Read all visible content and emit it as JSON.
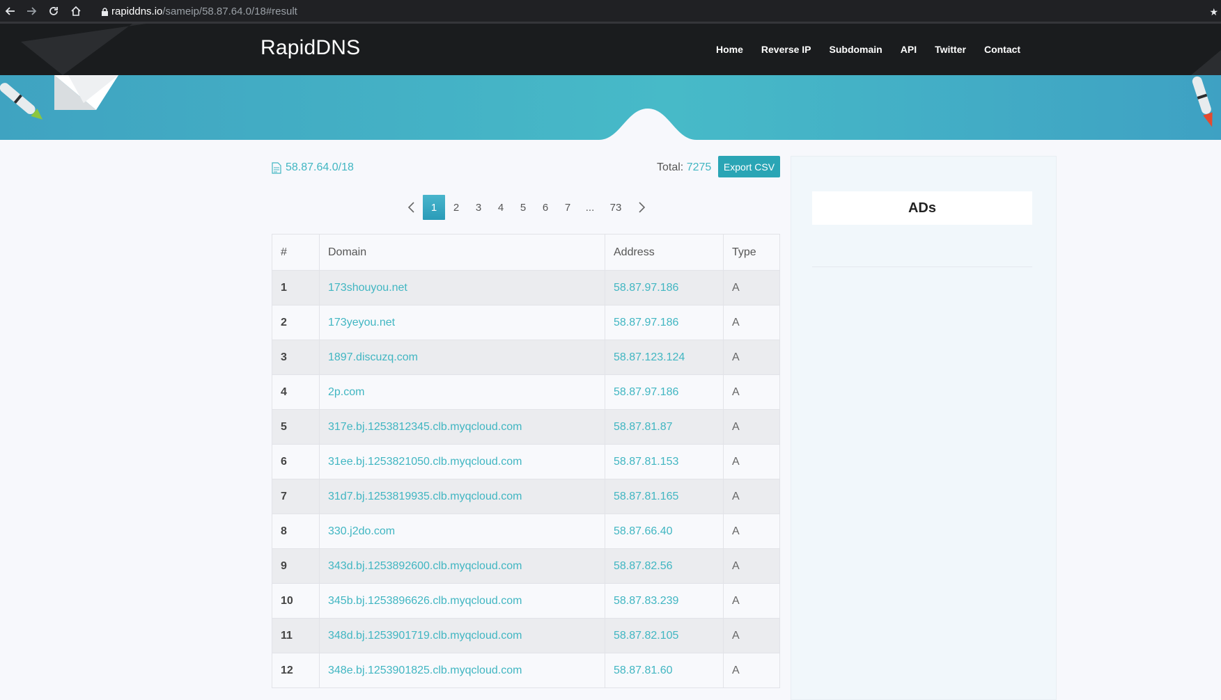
{
  "browser": {
    "url_host": "rapiddns.io",
    "url_path": "/sameip/58.87.64.0/18#result"
  },
  "header": {
    "brand": "RapidDNS",
    "menu": [
      "Home",
      "Reverse IP",
      "Subdomain",
      "API",
      "Twitter",
      "Contact"
    ]
  },
  "result": {
    "query": "58.87.64.0/18",
    "total_label": "Total:",
    "total_value": "7275",
    "export_label": "Export CSV"
  },
  "pagination": {
    "pages": [
      "1",
      "2",
      "3",
      "4",
      "5",
      "6",
      "7",
      "...",
      "73"
    ],
    "active": "1"
  },
  "table": {
    "headers": [
      "#",
      "Domain",
      "Address",
      "Type"
    ],
    "rows": [
      [
        "1",
        "173shouyou.net",
        "58.87.97.186",
        "A"
      ],
      [
        "2",
        "173yeyou.net",
        "58.87.97.186",
        "A"
      ],
      [
        "3",
        "1897.discuzq.com",
        "58.87.123.124",
        "A"
      ],
      [
        "4",
        "2p.com",
        "58.87.97.186",
        "A"
      ],
      [
        "5",
        "317e.bj.1253812345.clb.myqcloud.com",
        "58.87.81.87",
        "A"
      ],
      [
        "6",
        "31ee.bj.1253821050.clb.myqcloud.com",
        "58.87.81.153",
        "A"
      ],
      [
        "7",
        "31d7.bj.1253819935.clb.myqcloud.com",
        "58.87.81.165",
        "A"
      ],
      [
        "8",
        "330.j2do.com",
        "58.87.66.40",
        "A"
      ],
      [
        "9",
        "343d.bj.1253892600.clb.myqcloud.com",
        "58.87.82.56",
        "A"
      ],
      [
        "10",
        "345b.bj.1253896626.clb.myqcloud.com",
        "58.87.83.239",
        "A"
      ],
      [
        "11",
        "348d.bj.1253901719.clb.myqcloud.com",
        "58.87.82.105",
        "A"
      ],
      [
        "12",
        "348e.bj.1253901825.clb.myqcloud.com",
        "58.87.81.60",
        "A"
      ]
    ]
  },
  "sidebar": {
    "ads_label": "ADs"
  },
  "colors": {
    "accent": "#41b6c2",
    "header_bg": "#1a1c1e",
    "hero_bg": "#47bac8"
  },
  "icons": [
    "back-arrow-icon",
    "forward-arrow-icon",
    "reload-icon",
    "home-icon",
    "lock-icon",
    "file-icon",
    "chevron-left-icon",
    "chevron-right-icon"
  ]
}
